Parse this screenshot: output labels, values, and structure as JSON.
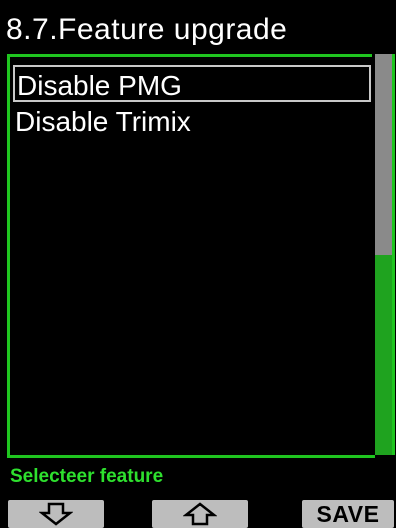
{
  "header": {
    "title": "8.7.Feature upgrade"
  },
  "menu": {
    "items": [
      {
        "label": "Disable PMG",
        "selected": true
      },
      {
        "label": "Disable Trimix",
        "selected": false
      }
    ]
  },
  "status": {
    "text": "Selecteer feature"
  },
  "softkeys": {
    "left_icon": "arrow-down-icon",
    "middle_icon": "arrow-up-icon",
    "right_label": "SAVE"
  },
  "colors": {
    "accent": "#1fc51f",
    "status_text": "#2ee02e",
    "selection_border": "#c8c8c8",
    "scroll_thumb": "#8a8a8a",
    "softkey_bg": "#bdbdbd"
  }
}
